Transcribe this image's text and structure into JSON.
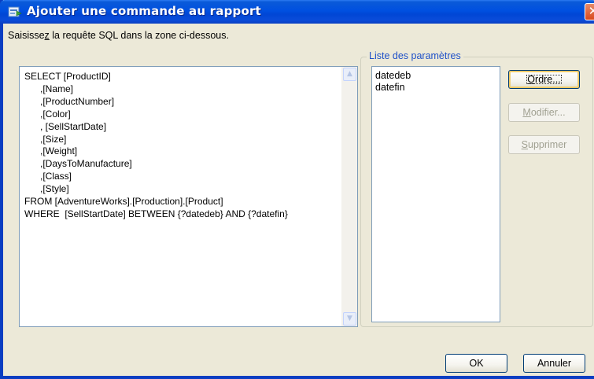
{
  "window": {
    "title": "Ajouter une commande au rapport",
    "close_glyph": "✕"
  },
  "instruction": {
    "before": "Saisisse",
    "mnemonic": "z",
    "after": " la requête SQL dans la zone ci-dessous."
  },
  "sql_query": "SELECT [ProductID]\n      ,[Name]\n      ,[ProductNumber]\n      ,[Color]\n      , [SellStartDate]\n      ,[Size]\n      ,[Weight]\n      ,[DaysToManufacture]\n      ,[Class]\n      ,[Style]\nFROM [AdventureWorks].[Production].[Product]\nWHERE  [SellStartDate] BETWEEN {?datedeb} AND {?datefin}",
  "parameters": {
    "legend": "Liste des paramètres",
    "items": [
      "datedeb",
      "datefin"
    ]
  },
  "buttons": {
    "order_mnemonic": "O",
    "order_rest": "rdre...",
    "modify_mnemonic": "M",
    "modify_rest": "odifier...",
    "delete_mnemonic": "S",
    "delete_rest": "upprimer",
    "ok": "OK",
    "cancel": "Annuler"
  },
  "icons": {
    "title": "window-app-icon",
    "scroll_up": "▲",
    "scroll_down": "▼"
  }
}
